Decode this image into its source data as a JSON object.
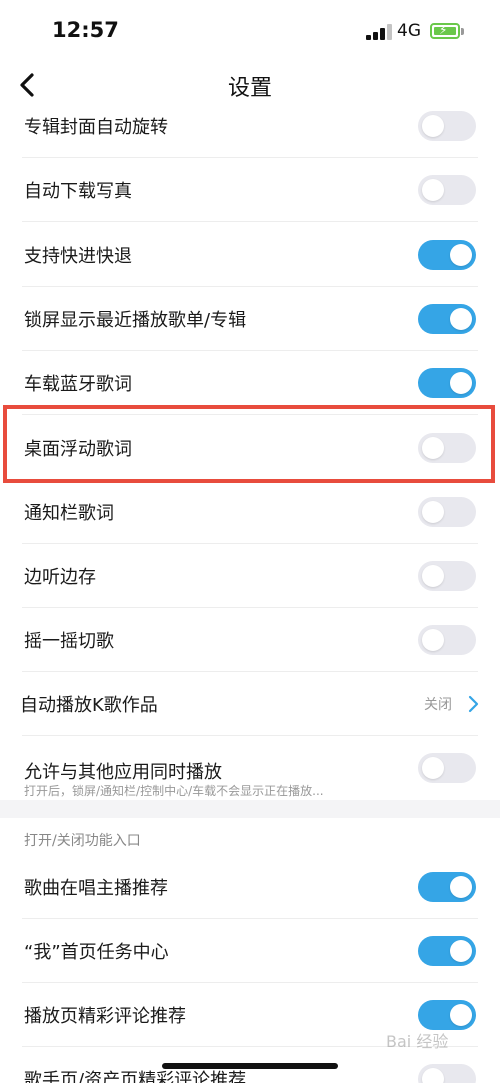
{
  "status_bar": {
    "time": "12:57",
    "network": "4G"
  },
  "nav": {
    "title": "设置"
  },
  "rows": [
    {
      "label": "专辑封面自动旋转",
      "on": false
    },
    {
      "label": "自动下载写真",
      "on": false
    },
    {
      "label": "支持快进快退",
      "on": true
    },
    {
      "label": "锁屏显示最近播放歌单/专辑",
      "on": true
    },
    {
      "label": "车载蓝牙歌词",
      "on": true
    },
    {
      "label": "桌面浮动歌词",
      "on": false
    },
    {
      "label": "通知栏歌词",
      "on": false
    },
    {
      "label": "边听边存",
      "on": false
    },
    {
      "label": "摇一摇切歌",
      "on": false
    }
  ],
  "auto_play_k": {
    "label": "自动播放K歌作品",
    "value": "关闭"
  },
  "simultaneous": {
    "label": "允许与其他应用同时播放",
    "sublabel": "打开后，锁屏/通知栏/控制中心/车载不会显示正在播放...",
    "on": false
  },
  "section": {
    "header": "打开/关闭功能入口"
  },
  "feature_rows": [
    {
      "label": "歌曲在唱主播推荐",
      "on": true
    },
    {
      "label": "“我”首页任务中心",
      "on": true
    },
    {
      "label": "播放页精彩评论推荐",
      "on": true
    },
    {
      "label": "歌手页/资产页精彩评论推荐",
      "on": false
    }
  ],
  "watermark": "Bai 经验",
  "colors": {
    "accent": "#35a5e6",
    "toggle_off": "#e8e8ee",
    "highlight": "#e84c3d"
  }
}
